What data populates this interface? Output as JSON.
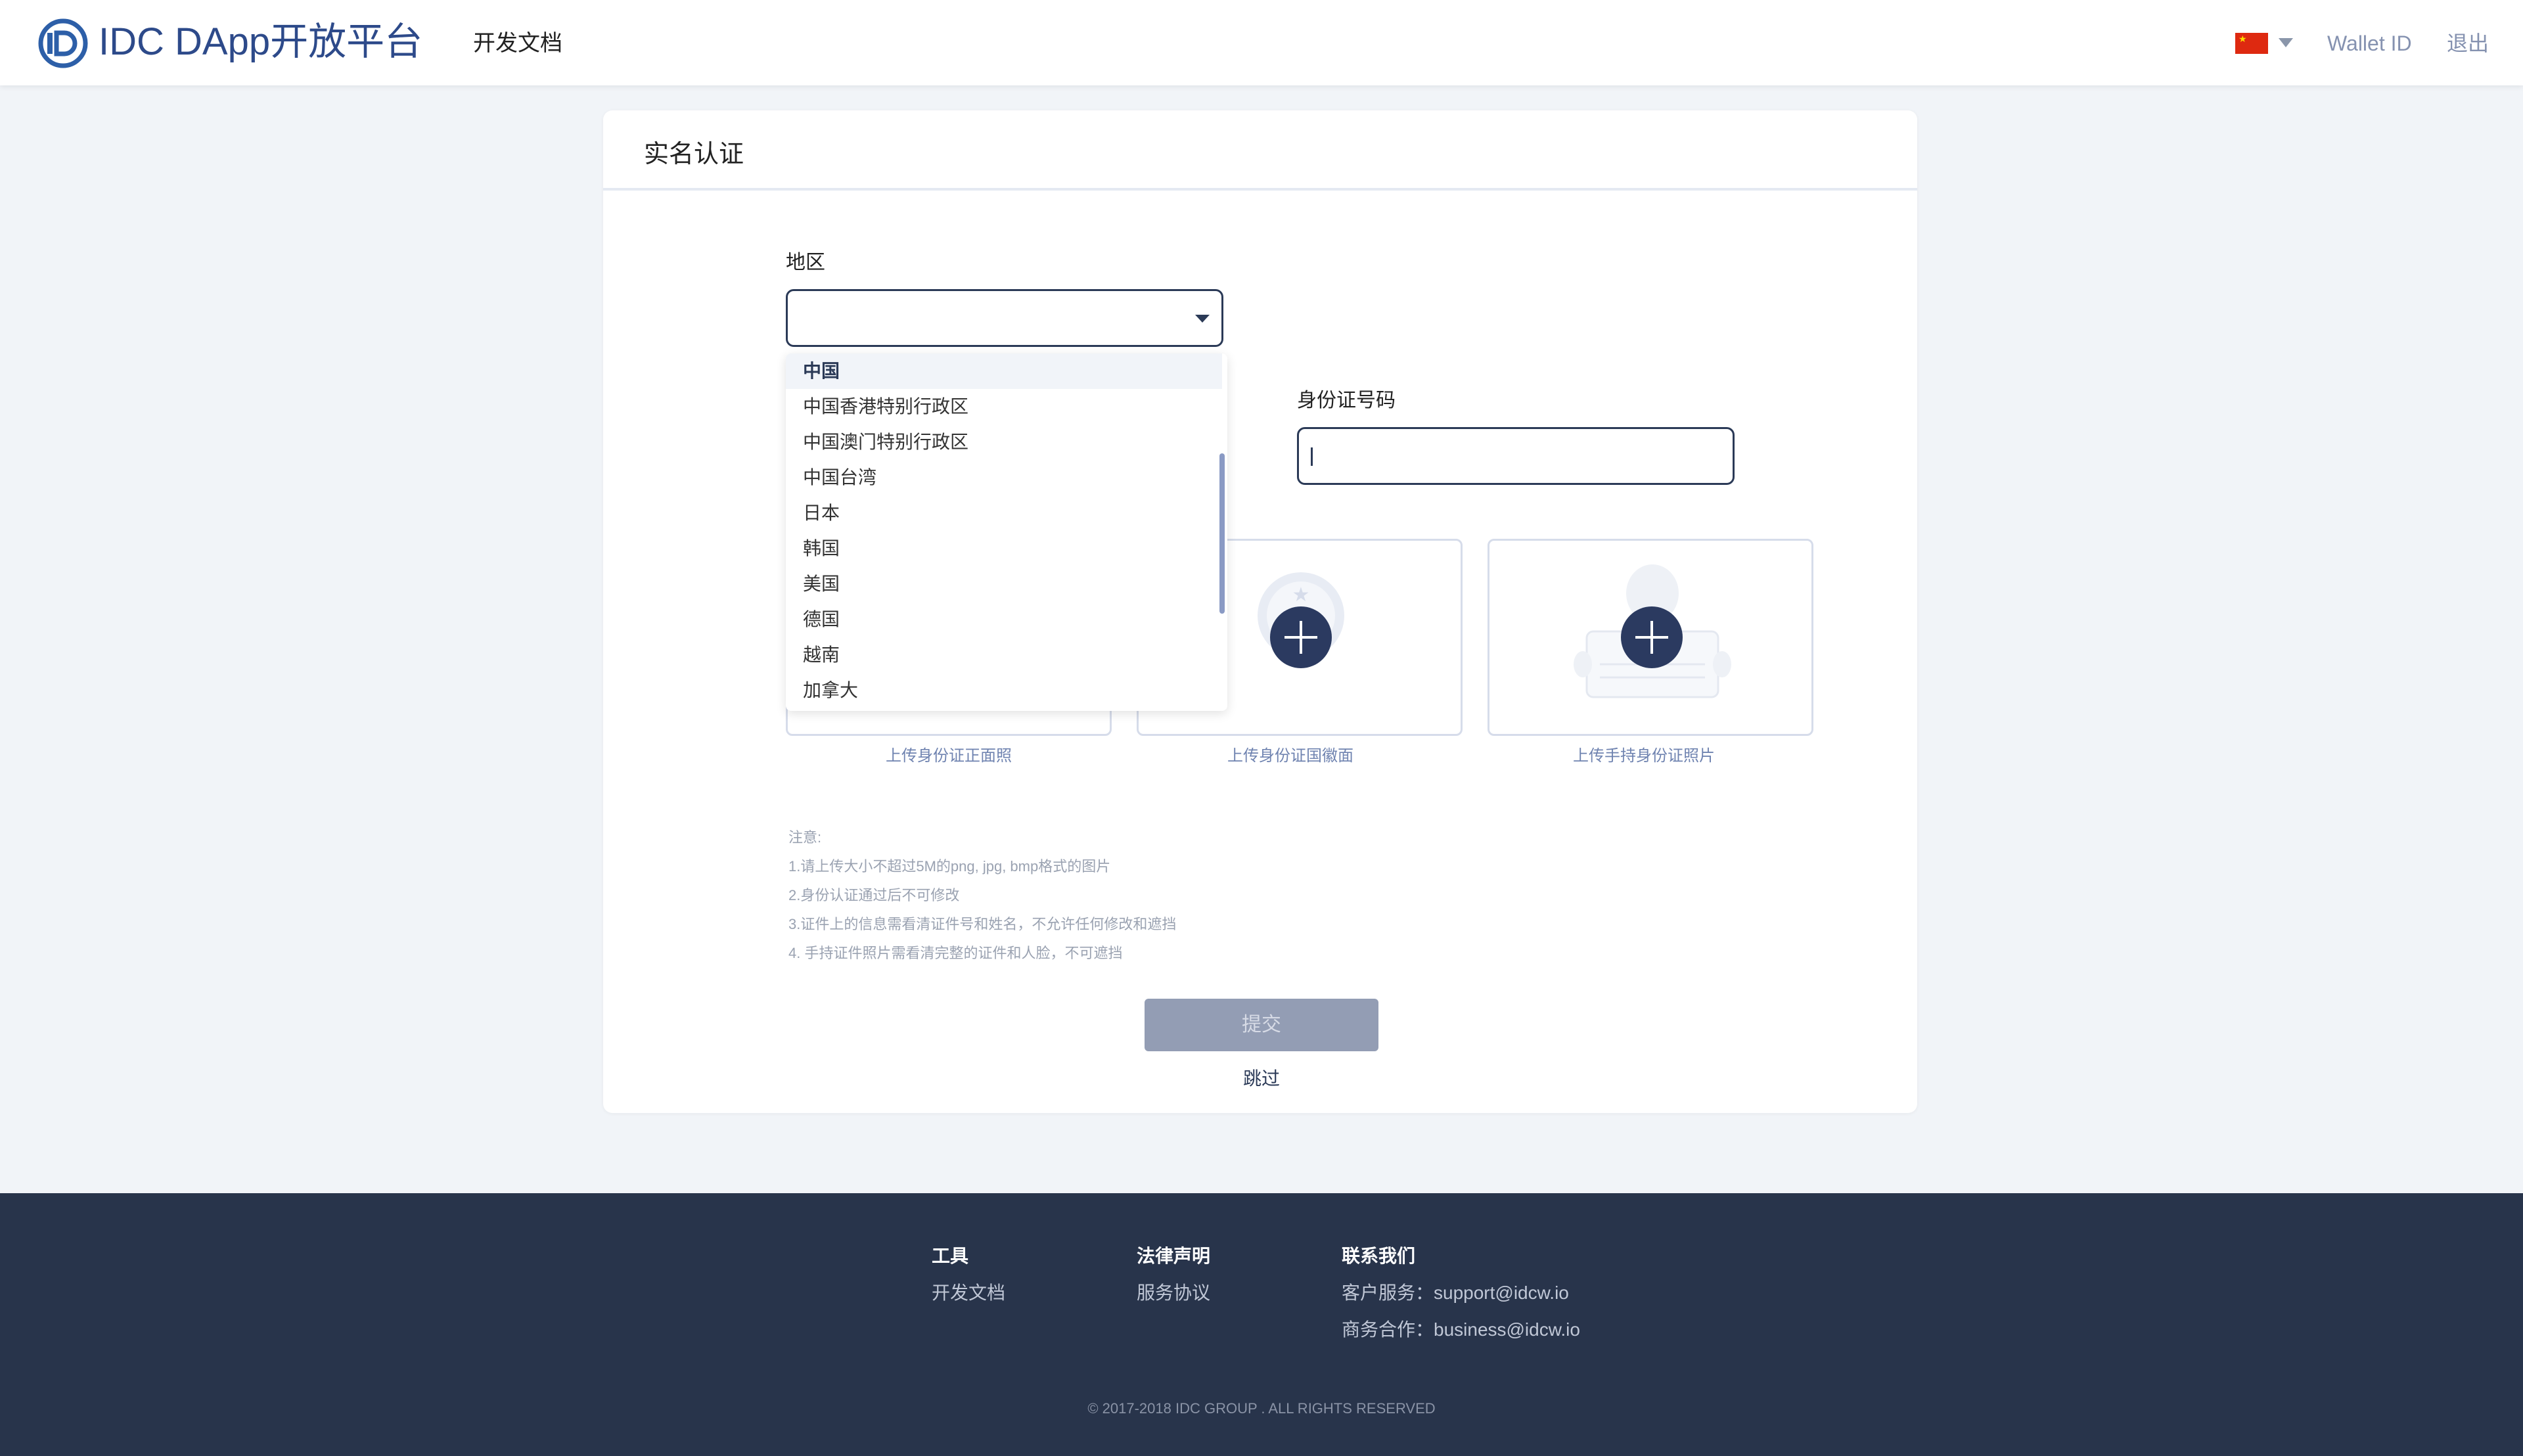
{
  "header": {
    "brand": "IDC DApp开放平台",
    "nav_docs": "开发文档",
    "wallet_id": "Wallet ID",
    "logout": "退出"
  },
  "card": {
    "title": "实名认证"
  },
  "form": {
    "region_label": "地区",
    "id_number_label": "身份证号码",
    "region_options": [
      "中国",
      "中国香港特别行政区",
      "中国澳门特别行政区",
      "中国台湾",
      "日本",
      "韩国",
      "美国",
      "德国",
      "越南",
      "加拿大"
    ],
    "uploads": [
      {
        "caption": "上传身份证正面照"
      },
      {
        "caption": "上传身份证国徽面"
      },
      {
        "caption": "上传手持身份证照片"
      }
    ],
    "notes": [
      "注意:",
      "1.请上传大小不超过5M的png, jpg, bmp格式的图片",
      "2.身份认证通过后不可修改",
      "3.证件上的信息需看清证件号和姓名，不允许任何修改和遮挡",
      "4. 手持证件照片需看清完整的证件和人脸，不可遮挡"
    ],
    "submit_label": "提交",
    "skip_label": "跳过"
  },
  "footer": {
    "col1_title": "工具",
    "col1_link": "开发文档",
    "col2_title": "法律声明",
    "col2_link": "服务协议",
    "col3_title": "联系我们",
    "support": "客户服务：support@idcw.io",
    "business": "商务合作：business@idcw.io",
    "copyright": "© 2017-2018 IDC GROUP . ALL RIGHTS RESERVED"
  },
  "colors": {
    "primary": "#2b3a57",
    "footer_bg": "#28344b",
    "page_bg": "#f1f4f8",
    "submit_disabled": "#939db4"
  }
}
